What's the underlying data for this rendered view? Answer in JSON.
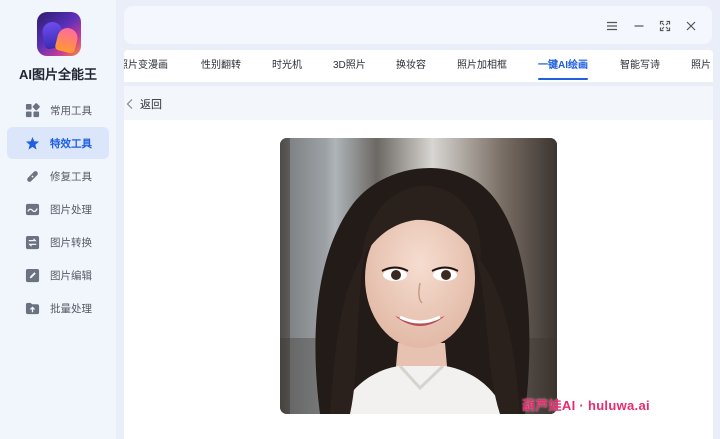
{
  "app": {
    "title": "AI图片全能王"
  },
  "sidebar": {
    "items": [
      {
        "label": "常用工具",
        "icon": "grid-icon",
        "active": false
      },
      {
        "label": "特效工具",
        "icon": "star-icon",
        "active": true
      },
      {
        "label": "修复工具",
        "icon": "bandage-icon",
        "active": false
      },
      {
        "label": "图片处理",
        "icon": "image-wave-icon",
        "active": false
      },
      {
        "label": "图片转换",
        "icon": "convert-icon",
        "active": false
      },
      {
        "label": "图片编辑",
        "icon": "edit-icon",
        "active": false
      },
      {
        "label": "批量处理",
        "icon": "folder-upload-icon",
        "active": false
      }
    ]
  },
  "window_controls": [
    "menu-icon",
    "minimize-icon",
    "fullscreen-icon",
    "close-icon"
  ],
  "tabs": [
    {
      "label": "照片变漫画",
      "active": false
    },
    {
      "label": "性别翻转",
      "active": false
    },
    {
      "label": "时光机",
      "active": false
    },
    {
      "label": "3D照片",
      "active": false
    },
    {
      "label": "换妆容",
      "active": false
    },
    {
      "label": "照片加相框",
      "active": false
    },
    {
      "label": "一键AI绘画",
      "active": true
    },
    {
      "label": "智能写诗",
      "active": false
    },
    {
      "label": "照片",
      "active": false
    }
  ],
  "content": {
    "back_label": "返回",
    "image_alt": "AI generated portrait photo"
  },
  "watermark": "葫芦娃AI · huluwa.ai",
  "colors": {
    "accent": "#1f5fe0",
    "sidebar_bg": "#f1f5fc",
    "active_item_bg": "#dbe6fb",
    "watermark": "#e82a6e"
  }
}
